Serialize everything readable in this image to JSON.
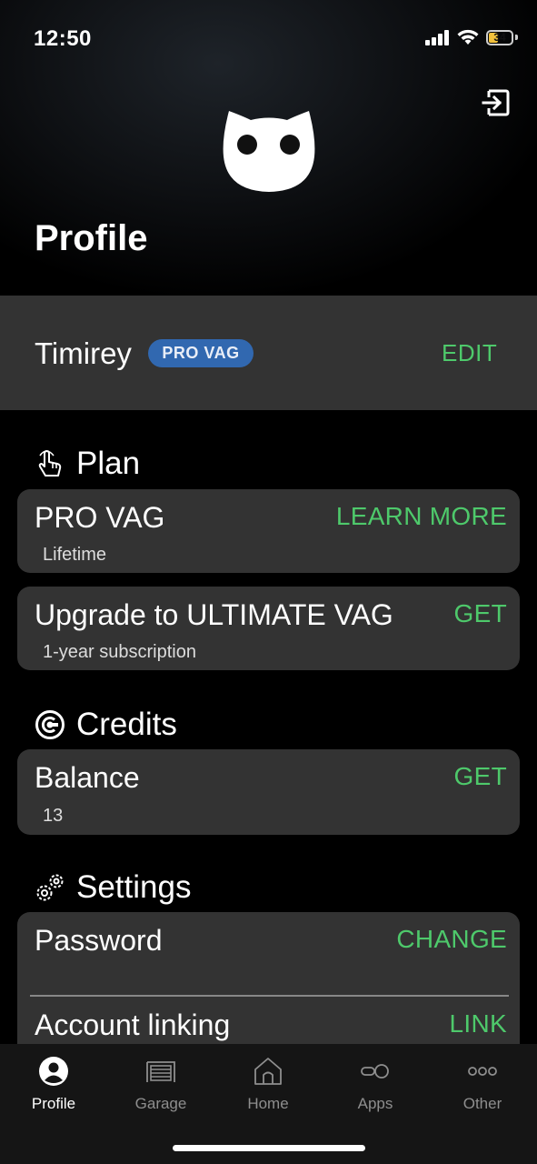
{
  "status_bar": {
    "time": "12:50",
    "battery": "34"
  },
  "header": {
    "title": "Profile"
  },
  "user": {
    "name": "Timirey",
    "badge": "PRO VAG",
    "edit_label": "EDIT"
  },
  "sections": {
    "plan": {
      "title": "Plan",
      "items": [
        {
          "title": "PRO VAG",
          "subtitle": "Lifetime",
          "action": "LEARN MORE"
        },
        {
          "title": "Upgrade to ULTIMATE VAG",
          "subtitle": "1-year subscription",
          "action": "GET"
        }
      ]
    },
    "credits": {
      "title": "Credits",
      "items": [
        {
          "title": "Balance",
          "subtitle": "13",
          "action": "GET"
        }
      ]
    },
    "settings": {
      "title": "Settings",
      "items": [
        {
          "title": "Password",
          "action": "CHANGE"
        },
        {
          "title": "Account linking",
          "action": "LINK"
        }
      ]
    }
  },
  "tabbar": {
    "tabs": [
      {
        "label": "Profile",
        "icon": "person-icon",
        "active": true
      },
      {
        "label": "Garage",
        "icon": "garage-icon"
      },
      {
        "label": "Home",
        "icon": "home-icon"
      },
      {
        "label": "Apps",
        "icon": "apps-icon"
      },
      {
        "label": "Other",
        "icon": "more-icon"
      }
    ]
  },
  "colors": {
    "accent": "#4ec96b",
    "badge": "#3168b0",
    "card": "#333333",
    "background": "#000000"
  }
}
